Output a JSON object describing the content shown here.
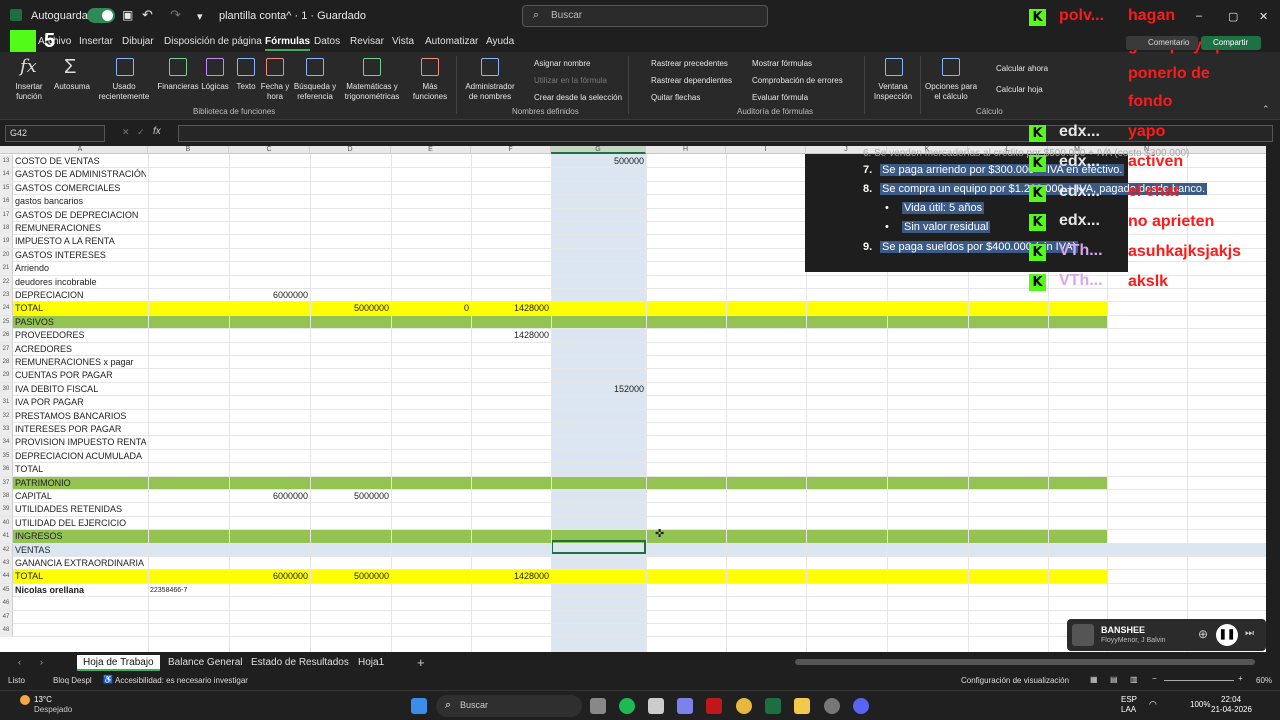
{
  "titlebar": {
    "autosave": "Autoguardado",
    "doc_title": "plantilla conta^ · 1 · Guardado",
    "search_placeholder": "Buscar",
    "comment_btn": "Comentario",
    "share_btn": "Compartir"
  },
  "menu": [
    "Archivo",
    "Insertar",
    "Dibujar",
    "Disposición de página",
    "Fórmulas",
    "Datos",
    "Revisar",
    "Vista",
    "Automatizar",
    "Ayuda"
  ],
  "ribbon": {
    "insert_function": "Insertar\nfunción",
    "autosum": "Autosuma",
    "recent": "Usado\nrecientemente",
    "financial": "Financieras",
    "logical": "Lógicas",
    "text": "Texto",
    "datetime": "Fecha y\nhora",
    "lookup": "Búsqueda y\nreferencia",
    "math": "Matemáticas y\ntrigonométricas",
    "more": "Más\nfunciones",
    "group_library": "Biblioteca de funciones",
    "name_manager": "Administrador\nde nombres",
    "assign_name": "Asignar nombre",
    "use_in_formula": "Utilizar en la fórmula",
    "create_from_sel": "Crear desde la selección",
    "group_names": "Nombres definidos",
    "trace_prec": "Rastrear precedentes",
    "trace_dep": "Rastrear dependientes",
    "remove_arrows": "Quitar flechas",
    "show_formulas": "Mostrar fórmulas",
    "error_check": "Comprobación de errores",
    "eval_formula": "Evaluar fórmula",
    "group_audit": "Auditoría de fórmulas",
    "watch": "Ventana\nInspección",
    "calc_options": "Opciones para\nel cálculo",
    "calc_now": "Calcular ahora",
    "calc_sheet": "Calcular hoja",
    "group_calc": "Cálculo"
  },
  "formula_bar": {
    "name_box": "G42",
    "fx": "fx",
    "value": ""
  },
  "columns": [
    "A",
    "B",
    "C",
    "D",
    "E",
    "F",
    "G",
    "H",
    "I",
    "J",
    "K",
    "L",
    "M",
    "N"
  ],
  "rows": [
    {
      "n": "13",
      "a": "COSTO DE VENTAS",
      "g": "500000"
    },
    {
      "n": "14",
      "a": "GASTOS DE ADMINISTRACIÓN"
    },
    {
      "n": "15",
      "a": "GASTOS COMERCIALES"
    },
    {
      "n": "16",
      "a": "gastos bancarios"
    },
    {
      "n": "17",
      "a": " GASTOS DE DEPRECIACION"
    },
    {
      "n": "18",
      "a": "REMUNERACIONES"
    },
    {
      "n": "19",
      "a": "IMPUESTO A LA RENTA"
    },
    {
      "n": "20",
      "a": "GASTOS INTERESES"
    },
    {
      "n": "21",
      "a": "Arriendo"
    },
    {
      "n": "22",
      "a": "deudores incobrable"
    },
    {
      "n": "23",
      "a": "DEPRECIACION",
      "c": "6000000"
    },
    {
      "n": "24",
      "a": "TOTAL",
      "d": "5000000",
      "e": "0",
      "f": "1428000",
      "style": "yellow"
    },
    {
      "n": "25",
      "a": "PASIVOS",
      "style": "green"
    },
    {
      "n": "26",
      "a": "PROVEEDORES",
      "f": "1428000"
    },
    {
      "n": "27",
      "a": "ACREDORES"
    },
    {
      "n": "28",
      "a": "REMUNERACIONES x pagar"
    },
    {
      "n": "29",
      "a": "CUENTAS POR PAGAR"
    },
    {
      "n": "30",
      "a": "IVA DEBITO FISCAL",
      "g": "152000"
    },
    {
      "n": "31",
      "a": "IVA POR PAGAR"
    },
    {
      "n": "32",
      "a": "PRESTAMOS BANCARIOS"
    },
    {
      "n": "33",
      "a": "INTERESES POR PAGAR"
    },
    {
      "n": "34",
      "a": "PROVISION IMPUESTO RENTA"
    },
    {
      "n": "35",
      "a": "DEPRECIACION ACUMULADA"
    },
    {
      "n": "36",
      "a": "TOTAL"
    },
    {
      "n": "37",
      "a": "PATRIMONIO",
      "style": "green"
    },
    {
      "n": "38",
      "a": "CAPITAL",
      "c": "6000000",
      "d": "5000000"
    },
    {
      "n": "39",
      "a": "UTILIDADES RETENIDAS"
    },
    {
      "n": "40",
      "a": "UTILIDAD DEL EJERCICIO"
    },
    {
      "n": "41",
      "a": "INGRESOS",
      "style": "green"
    },
    {
      "n": "42",
      "a": "VENTAS",
      "style": "selrow"
    },
    {
      "n": "43",
      "a": "GANANCIA EXTRAORDINARIA"
    },
    {
      "n": "44",
      "a": "TOTAL",
      "c": "6000000",
      "d": "5000000",
      "f": "1428000",
      "style": "yellow"
    },
    {
      "n": "45",
      "a": "Nicolas orellana",
      "b": "22358466-7",
      "style": "bold"
    },
    {
      "n": "46"
    },
    {
      "n": "47"
    },
    {
      "n": "48"
    }
  ],
  "overlay_lines": {
    "l6": "6. Se venden mercaderías al crédito por $500.000 + IVA (costo $300.000)",
    "l7_num": "7.",
    "l7": "Se paga arriendo por $300.000 + IVA en efectivo.",
    "l8_num": "8.",
    "l8": "Se compra un equipo por $1.200.000 + IVA, pagado desde banco.",
    "l8a": "Vida útil: 5 años",
    "l8b": "Sin valor residual",
    "l9_num": "9.",
    "l9": "Se paga sueldos por $400.000 (sin IVA)"
  },
  "chat": {
    "names": [
      "polv...",
      "edx...",
      "edx...",
      "edx...",
      "edx...",
      "VTh...",
      "VTh..."
    ],
    "messages": [
      "hagan",
      "gameplays pa",
      "ponerlo de",
      "fondo",
      "yapo",
      "activen",
      "el chat",
      "no aprieten",
      "asuhkajksjakjs",
      "akslk"
    ],
    "logo_text": "5"
  },
  "sheet_tabs": [
    "Hoja de Trabajo",
    "Balance General",
    "Estado de Resultados",
    "Hoja1"
  ],
  "status": {
    "ready": "Listo",
    "scroll_lock": "Bloq Despl",
    "accessibility": "Accesibilidad: es necesario investigar",
    "view_settings": "Configuración de visualización",
    "zoom": "60%"
  },
  "music": {
    "title": "BANSHEE",
    "artist": "FloyyMenor, J Balvin"
  },
  "taskbar": {
    "weather_temp": "13°C",
    "weather_desc": "Despejado",
    "search": "Buscar",
    "lang1": "ESP",
    "lang2": "LAA",
    "battery": "100%",
    "time": "22:04",
    "date": "21-04-2026"
  },
  "colors": {
    "yellow": "#ffff00",
    "green": "#92c353",
    "selected_col": "#dbe6f1",
    "accent": "#3fae5e"
  }
}
